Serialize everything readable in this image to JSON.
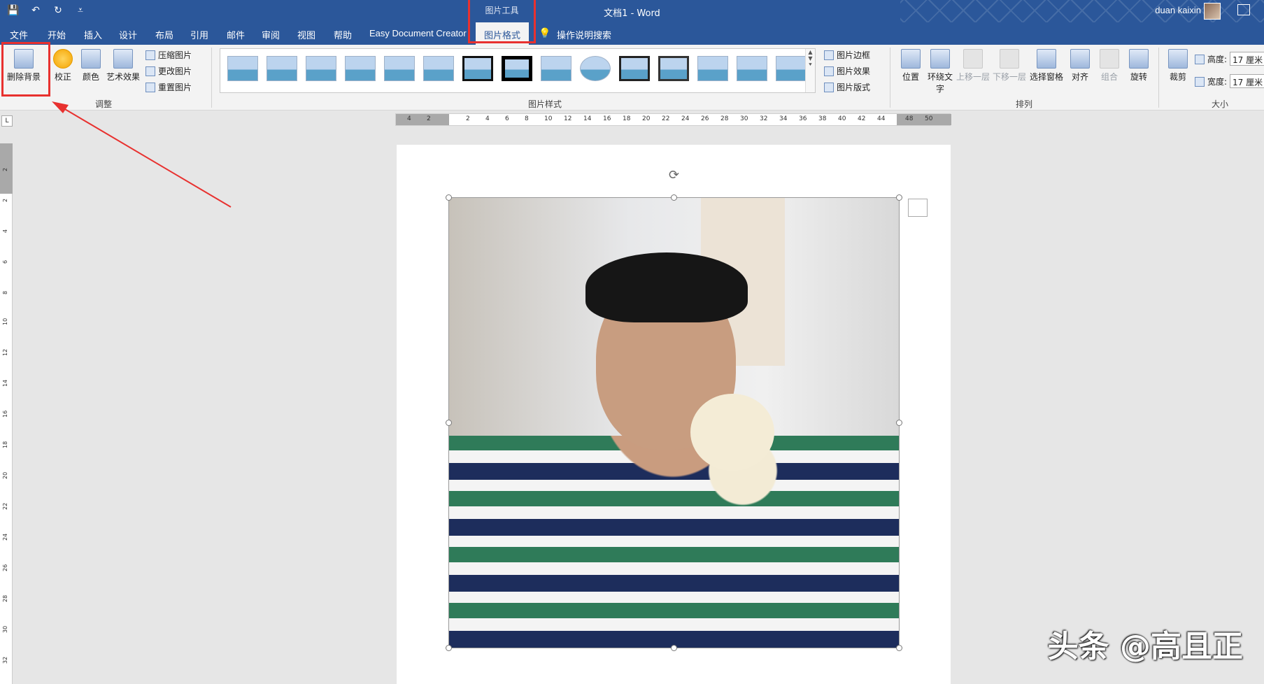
{
  "title_bar": {
    "doc_title": "文档1  -  Word",
    "context_group": "图片工具",
    "user_name": "duan kaixin"
  },
  "tabs": [
    "文件",
    "开始",
    "插入",
    "设计",
    "布局",
    "引用",
    "邮件",
    "审阅",
    "视图",
    "帮助",
    "Easy Document Creator"
  ],
  "active_tab": "图片格式",
  "tell_me": "操作说明搜索",
  "ribbon": {
    "adjust": {
      "remove_bg": "删除背景",
      "correct": "校正",
      "color": "颜色",
      "art_effects": "艺术效果",
      "compress": "压缩图片",
      "change": "更改图片",
      "reset": "重置图片",
      "label": "调整"
    },
    "styles": {
      "label": "图片样式",
      "border": "图片边框",
      "effects": "图片效果",
      "layout": "图片版式"
    },
    "arrange": {
      "label": "排列",
      "position": "位置",
      "wrap": "环绕文字",
      "forward": "上移一层",
      "backward": "下移一层",
      "pane": "选择窗格",
      "align": "对齐",
      "group": "组合",
      "rotate": "旋转"
    },
    "size": {
      "label": "大小",
      "crop": "裁剪",
      "height_label": "高度:",
      "height_value": "17 厘米",
      "width_label": "宽度:",
      "width_value": "17 厘米"
    }
  },
  "ruler": {
    "h_ticks": [
      "4",
      "2",
      "2",
      "4",
      "6",
      "8",
      "10",
      "12",
      "14",
      "16",
      "18",
      "20",
      "22",
      "24",
      "26",
      "28",
      "30",
      "32",
      "34",
      "36",
      "38",
      "40",
      "42",
      "44",
      "48",
      "50"
    ],
    "v_ticks": [
      "2",
      "2",
      "4",
      "6",
      "8",
      "10",
      "12",
      "14",
      "16",
      "18",
      "20",
      "22",
      "24",
      "26",
      "28",
      "30",
      "32"
    ]
  },
  "watermark": "头条 @高且正",
  "colors": {
    "brand": "#2b579a",
    "highlight": "#e8312f"
  }
}
